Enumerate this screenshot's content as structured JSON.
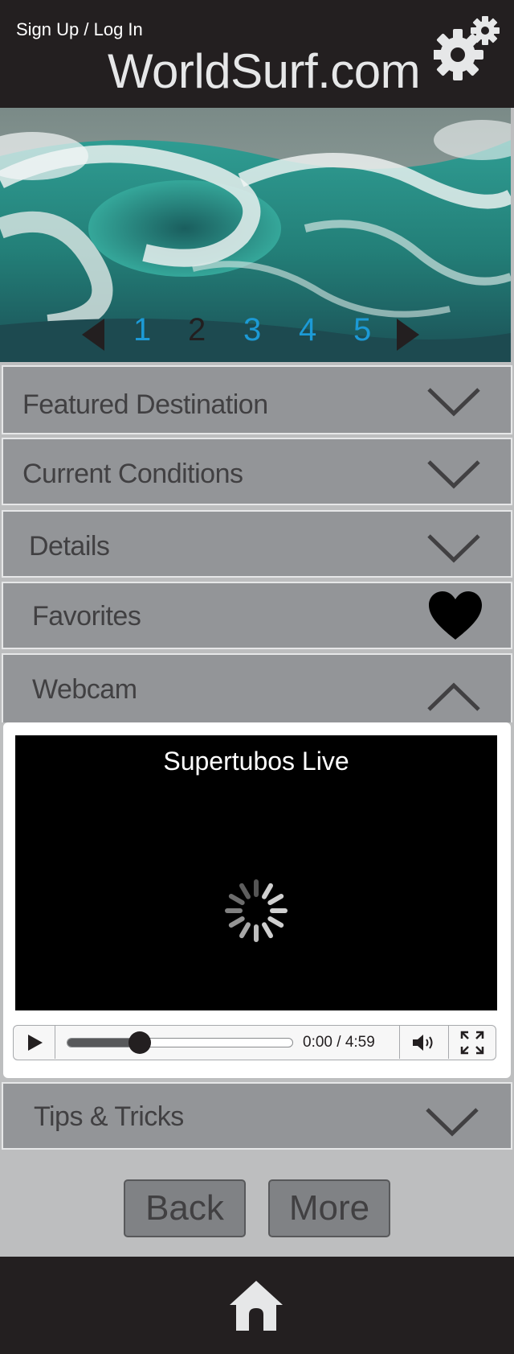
{
  "header": {
    "signin_label": "Sign Up / Log In",
    "brand": "WorldSurf.com",
    "settings_icon": "gear-icon",
    "background": "#231f20"
  },
  "carousel": {
    "pages": [
      "1",
      "2",
      "3",
      "4",
      "5"
    ],
    "active_page": "2",
    "prev_icon": "triangle-left-icon",
    "next_icon": "triangle-right-icon",
    "inactive_color": "#1c9ad6"
  },
  "sections": {
    "featured": {
      "label": "Featured Destination",
      "icon": "chevron-down-icon"
    },
    "conditions": {
      "label": "Current Conditions",
      "icon": "chevron-down-icon"
    },
    "details": {
      "label": "Details",
      "icon": "chevron-down-icon"
    },
    "favorites": {
      "label": "Favorites",
      "icon": "heart-icon"
    },
    "webcam": {
      "label": "Webcam",
      "icon": "chevron-up-icon"
    },
    "tips": {
      "label": "Tips & Tricks",
      "icon": "chevron-down-icon"
    }
  },
  "webcam": {
    "title": "Supertubos Live",
    "status_icon": "loading-spinner-icon",
    "time_display": "0:00 / 4:59",
    "progress_fraction": 0.32,
    "controls": [
      "play-icon",
      "volume-icon",
      "fullscreen-icon"
    ]
  },
  "buttons": {
    "back": "Back",
    "more": "More"
  },
  "footer": {
    "home_icon": "home-icon"
  }
}
